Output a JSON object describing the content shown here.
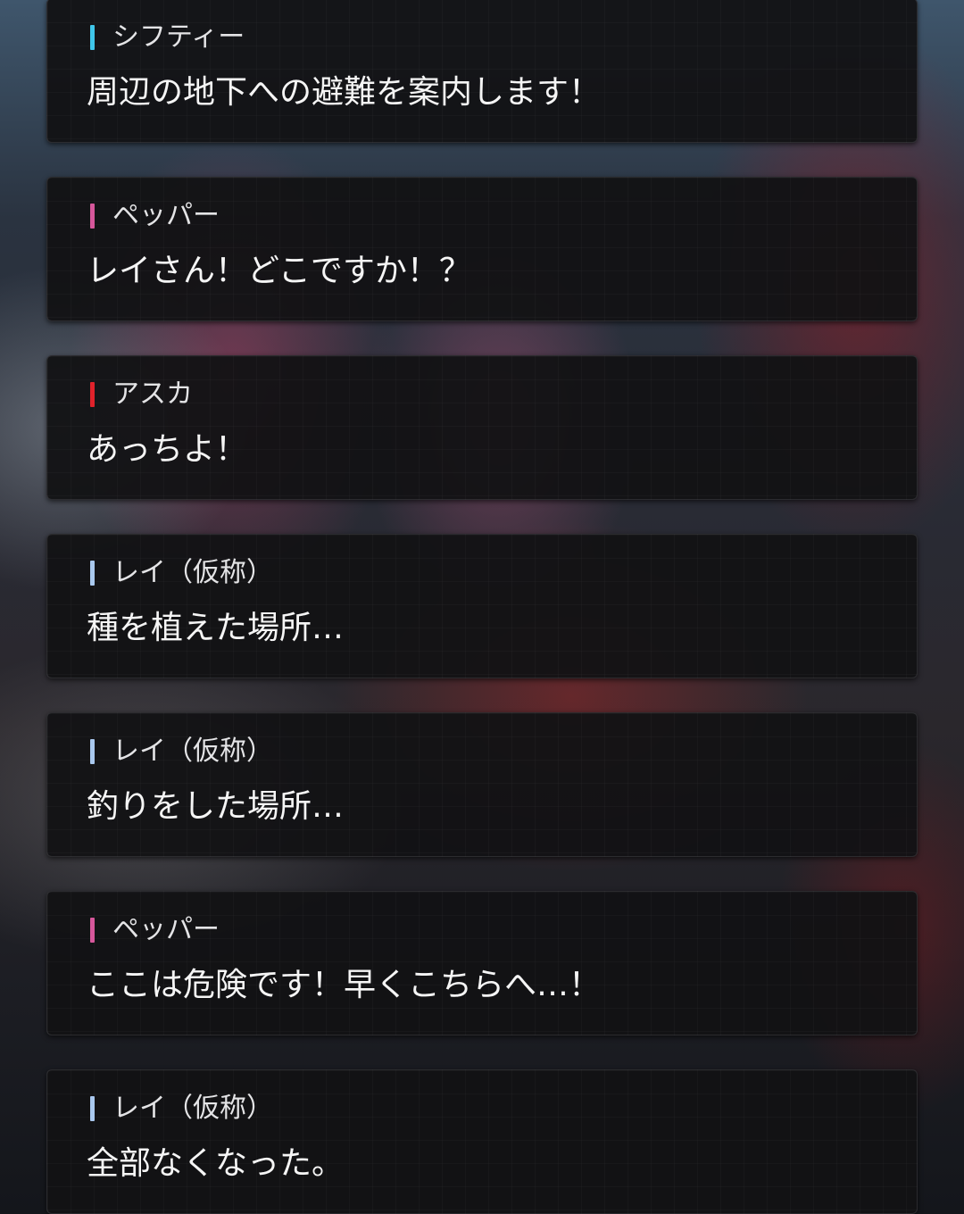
{
  "theme": {
    "speaker_colors": {
      "cyan": "#3fc6ea",
      "pink": "#d6579b",
      "red": "#e0222b",
      "light_blue": "#a9c8ee"
    }
  },
  "messages": [
    {
      "speaker": "シフティー",
      "color": "#3fc6ea",
      "text": "周辺の地下への避難を案内します！"
    },
    {
      "speaker": "ペッパー",
      "color": "#d6579b",
      "text": "レイさん！どこですか！？"
    },
    {
      "speaker": "アスカ",
      "color": "#e0222b",
      "text": "あっちよ！"
    },
    {
      "speaker": "レイ（仮称）",
      "color": "#a9c8ee",
      "text": "種を植えた場所…"
    },
    {
      "speaker": "レイ（仮称）",
      "color": "#a9c8ee",
      "text": "釣りをした場所…"
    },
    {
      "speaker": "ペッパー",
      "color": "#d6579b",
      "text": "ここは危険です！早くこちらへ…！"
    },
    {
      "speaker": "レイ（仮称）",
      "color": "#a9c8ee",
      "text": "全部なくなった。"
    }
  ]
}
